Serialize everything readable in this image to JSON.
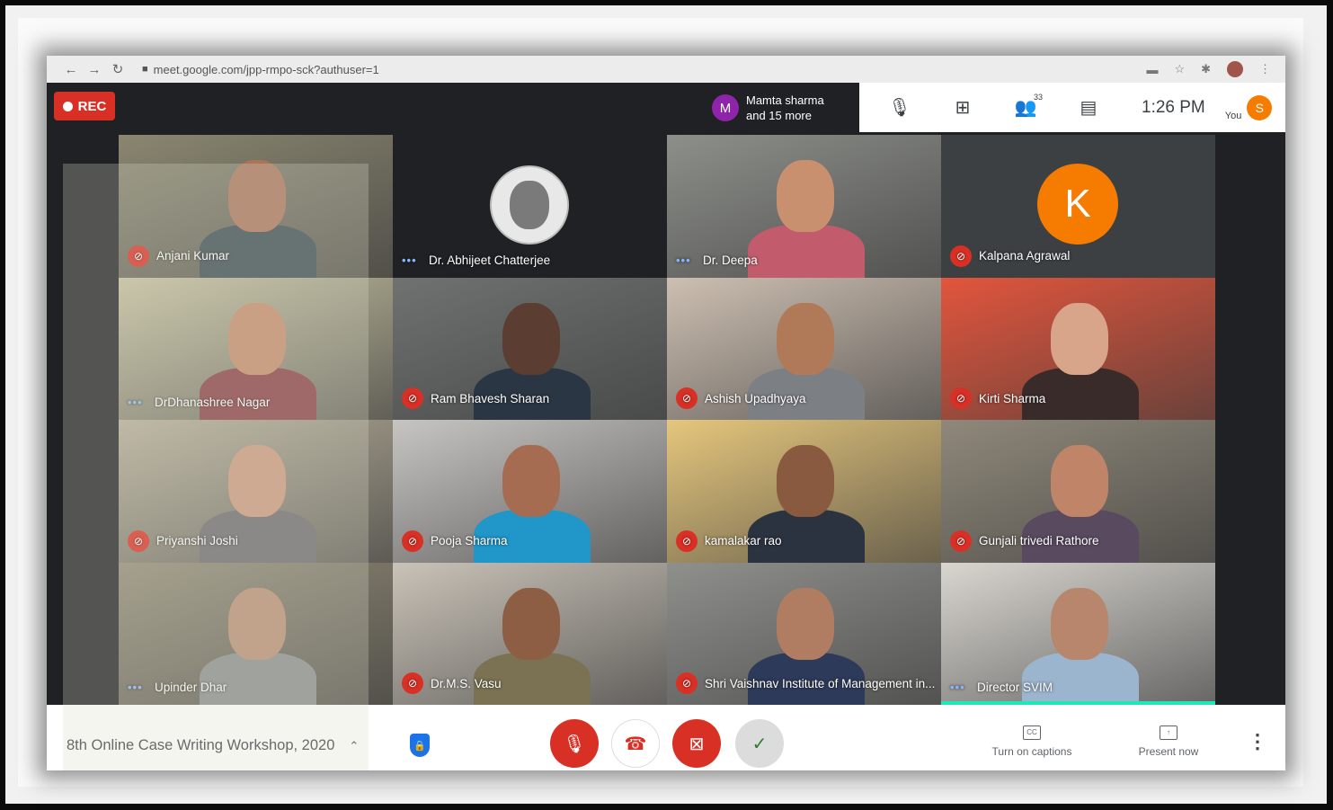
{
  "browser": {
    "url": "meet.google.com/jpp-rmpo-sck?authuser=1"
  },
  "topbar": {
    "rec_label": "REC",
    "presence_initial": "M",
    "presence_line1": "Mamta sharma",
    "presence_line2": "and 15 more",
    "participants_count": "33",
    "time": "1:26 PM",
    "you_label": "You",
    "self_initial": "S"
  },
  "participants": [
    {
      "name": "Anjani Kumar",
      "status": "muted",
      "bg": "#8a8670",
      "skin": "#a8745a",
      "shirt": "#3b4a52"
    },
    {
      "name": "Dr. Abhijeet Chatterjee",
      "status": "dots",
      "avatar": "photo"
    },
    {
      "name": "Dr. Deepa",
      "status": "dots",
      "bg": "#8d8f8a",
      "skin": "#c99070",
      "shirt": "#c25c6c"
    },
    {
      "name": "Kalpana Agrawal",
      "status": "muted",
      "avatar_letter": "K",
      "avatar_color": "#f57c00"
    },
    {
      "name": "DrDhanashree Nagar",
      "status": "dots",
      "bg": "#c4bf9f",
      "skin": "#c48a6a",
      "shirt": "#8a3e44"
    },
    {
      "name": "Ram Bhavesh Sharan",
      "status": "muted",
      "bg": "#6e7270",
      "skin": "#5b3d32",
      "shirt": "#2a3644"
    },
    {
      "name": "Ashish Upadhyaya",
      "status": "muted",
      "bg": "#cdbfb1",
      "skin": "#b07a58",
      "shirt": "#7c7f84"
    },
    {
      "name": "Kirti Sharma",
      "status": "muted",
      "bg": "#e2553c",
      "skin": "#d8a58a",
      "shirt": "#3a2b2b"
    },
    {
      "name": "Priyanshi Joshi",
      "status": "muted",
      "bg": "#b5ad98",
      "skin": "#c8977c",
      "shirt": "#6b6a70"
    },
    {
      "name": "Pooja Sharma",
      "status": "muted",
      "bg": "#c7c5c2",
      "skin": "#a66c52",
      "shirt": "#2196c8"
    },
    {
      "name": "kamalakar rao",
      "status": "muted",
      "bg": "#e5c67c",
      "skin": "#8a5a40",
      "shirt": "#2b3340"
    },
    {
      "name": "Gunjali trivedi Rathore",
      "status": "muted",
      "bg": "#8f887a",
      "skin": "#c08468",
      "shirt": "#5a4a60"
    },
    {
      "name": "Upinder Dhar",
      "status": "dots",
      "bg": "#918a76",
      "skin": "#b88c74",
      "shirt": "#8a8c8e"
    },
    {
      "name": "Dr.M.S. Vasu",
      "status": "muted",
      "bg": "#c9c2b7",
      "skin": "#8e5e44",
      "shirt": "#7a7252"
    },
    {
      "name": "Shri Vaishnav Institute of Management in...",
      "status": "muted",
      "bg": "#8f908c",
      "skin": "#b07c62",
      "shirt": "#2d3a5a"
    },
    {
      "name": "Director SVIM",
      "status": "dots",
      "bg": "#d9d6d0",
      "skin": "#b8866c",
      "shirt": "#9cb5cf",
      "speaking": true
    }
  ],
  "bottombar": {
    "meeting_title": "8th Online Case Writing Workshop, 2020",
    "captions_label": "Turn on captions",
    "present_label": "Present now"
  },
  "colors": {
    "red": "#d93025",
    "rec": "#d93025",
    "speaking": "#1de9b6",
    "orange": "#f57c00"
  }
}
